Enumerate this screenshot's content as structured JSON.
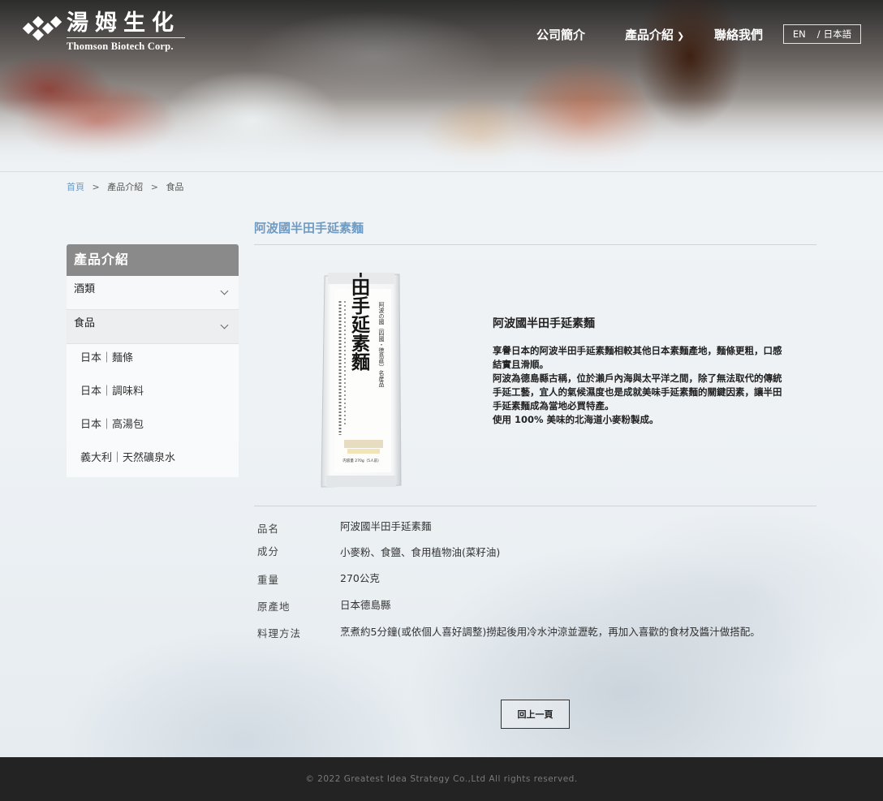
{
  "brand": {
    "name_cn": "湯姆生化",
    "name_en": "Thomson Biotech Corp."
  },
  "nav": {
    "items": [
      {
        "label": "公司簡介"
      },
      {
        "label": "產品介紹"
      },
      {
        "label": "聯絡我們"
      }
    ],
    "lang_en": "EN",
    "lang_sep": "/",
    "lang_jp": "日本語"
  },
  "breadcrumb": {
    "home": "首頁",
    "sep": ">",
    "level1": "產品介紹",
    "level2": "食品"
  },
  "sidebar": {
    "title": "產品介紹",
    "categories": [
      {
        "label": "酒類"
      },
      {
        "label": "食品"
      }
    ],
    "subitems": [
      {
        "label": "日本｜麵條"
      },
      {
        "label": "日本｜調味料"
      },
      {
        "label": "日本｜高湯包"
      },
      {
        "label": "義大利｜天然礦泉水"
      }
    ]
  },
  "product": {
    "title": "阿波國半田手延素麵",
    "desc_title": "阿波國半田手延素麵",
    "desc_lines": [
      "享譽日本的阿波半田手延素麵相較其他日本素麵產地，麵條更粗，口感結實且滑順。",
      "阿波為德島縣古稱，位於瀨戶內海與太平洋之間，除了無法取代的傳統手延工藝，宜人的氣候濕度也是成就美味手延素麵的關鍵因素，讓半田手延素麵成為當地必買特產。",
      "使用 100% 美味的北海道小麥粉製成。"
    ],
    "package": {
      "big_text": "半田手延素麵",
      "small_text": "阿波の國（四國・徳島県）名産品",
      "weight_text": "内容量 270g（5人前）"
    },
    "specs": [
      {
        "label": "品名",
        "value": "阿波國半田手延素麵"
      },
      {
        "label": "成分",
        "value": "小麥粉、食鹽、食用植物油(菜籽油)"
      },
      {
        "label": "重量",
        "value": "270公克"
      },
      {
        "label": "原產地",
        "value": "日本德島縣"
      },
      {
        "label": "料理方法",
        "value": "烹煮約5分鐘(或依個人喜好調整)撈起後用冷水沖涼並瀝乾，再加入喜歡的食材及醬汁做搭配。"
      }
    ]
  },
  "back_button": "回上一頁",
  "footer": {
    "copyright": "© 2022 Greatest Idea Strategy Co.,Ltd All rights reserved."
  }
}
